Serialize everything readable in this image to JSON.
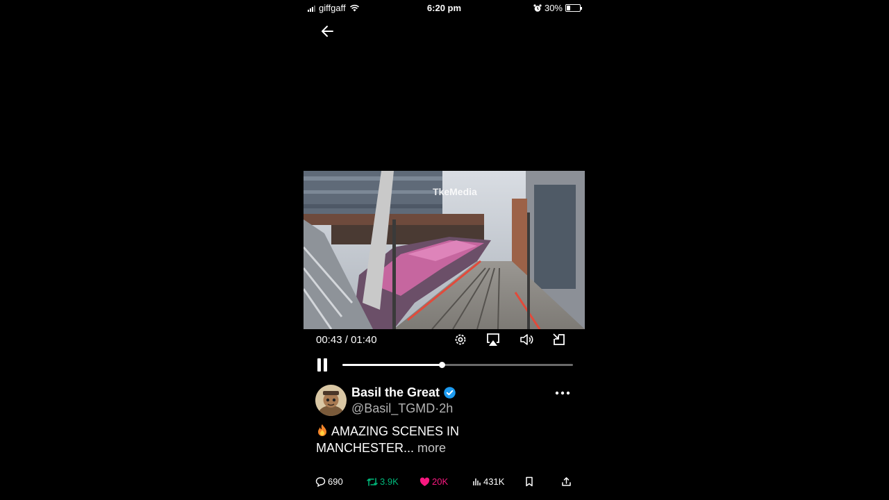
{
  "status_bar": {
    "carrier": "giffgaff",
    "time": "6:20 pm",
    "battery": "30%",
    "battery_level": 0.3,
    "icons": [
      "signal-icon",
      "wifi-icon",
      "alarm-icon",
      "battery-icon"
    ]
  },
  "nav": {
    "back_icon": "arrow-left-icon"
  },
  "video": {
    "watermark": "TkeMedia",
    "current_time": "00:43",
    "separator": " / ",
    "duration": "01:40",
    "progress": 0.43,
    "controls": [
      "settings-icon",
      "airplay-icon",
      "volume-icon",
      "minimize-icon",
      "pause-icon"
    ]
  },
  "tweet": {
    "author_name": "Basil the Great",
    "handle": "@Basil_TGMD",
    "separator": "·",
    "time_ago": "2h",
    "text_line1": "AMAZING SCENES IN",
    "text_line2": "MANCHESTER...",
    "more_label": "more",
    "text_icon": "fire-emoji-icon",
    "verified": true
  },
  "actions": {
    "replies": "690",
    "retweets": "3.9K",
    "likes": "20K",
    "views": "431K",
    "retweet_color": "#00ba7c",
    "like_color": "#f91880"
  },
  "colors": {
    "background": "#000000",
    "verified_blue": "#1d9bf0"
  }
}
